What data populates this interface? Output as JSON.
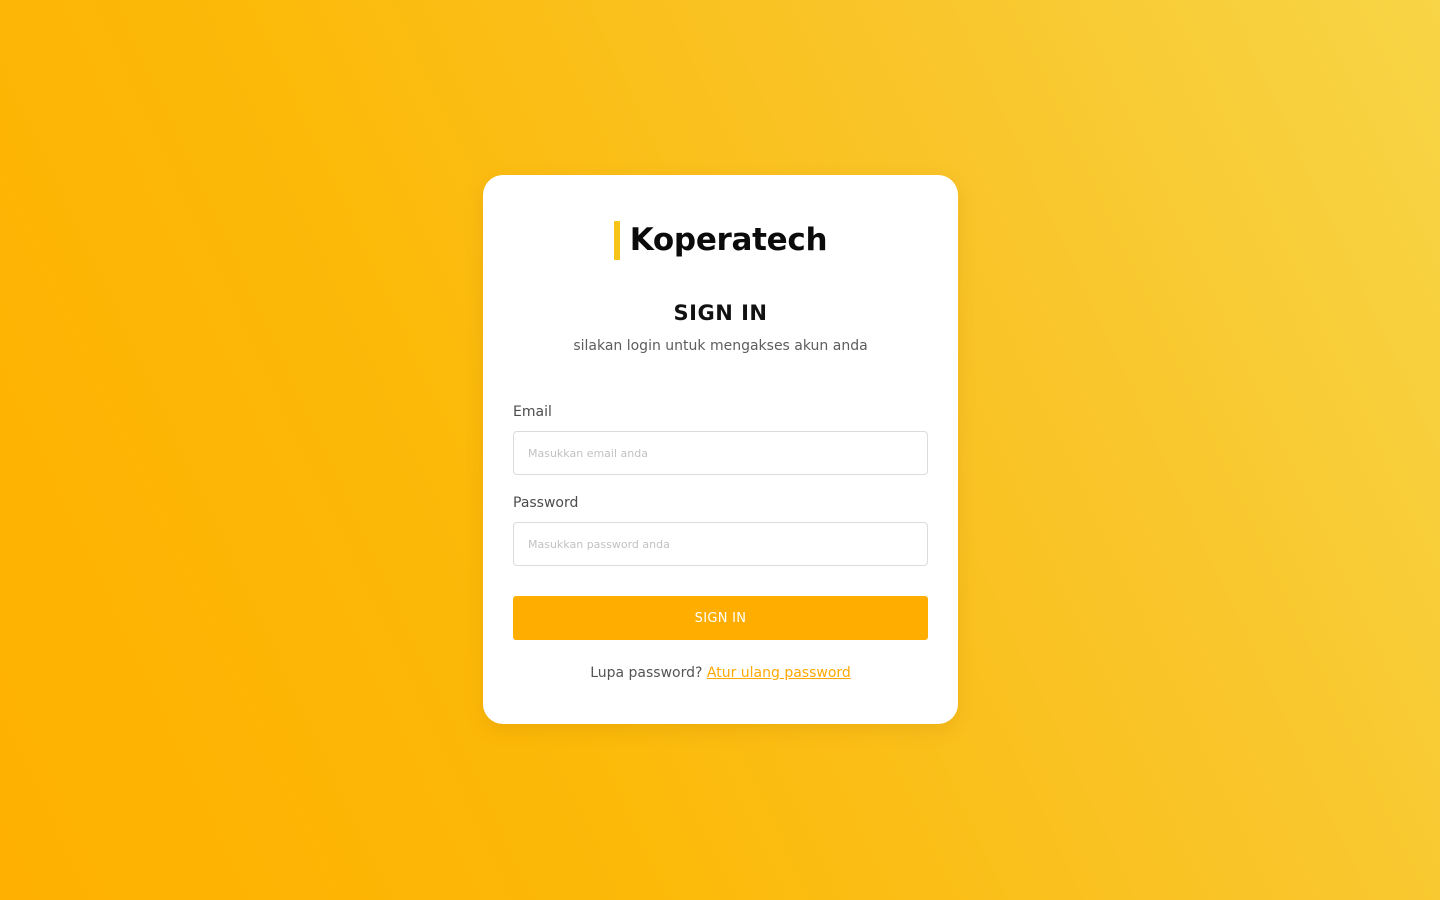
{
  "brand": {
    "name": "Koperatech",
    "accent_color": "#f6c318"
  },
  "signin": {
    "title": "SIGN IN",
    "subtitle": "silakan login untuk mengakses akun anda"
  },
  "form": {
    "email_label": "Email",
    "email_placeholder": "Masukkan email anda",
    "email_value": "",
    "password_label": "Password",
    "password_placeholder": "Masukkan password anda",
    "password_value": "",
    "submit_label": "SIGN IN",
    "button_color": "#ffae00"
  },
  "footer": {
    "forgot_text": "Lupa password?",
    "reset_link": "Atur ulang password",
    "link_color": "#ffa800"
  },
  "background": {
    "gradient_from": "#ffb000",
    "gradient_to": "#f8d546"
  }
}
